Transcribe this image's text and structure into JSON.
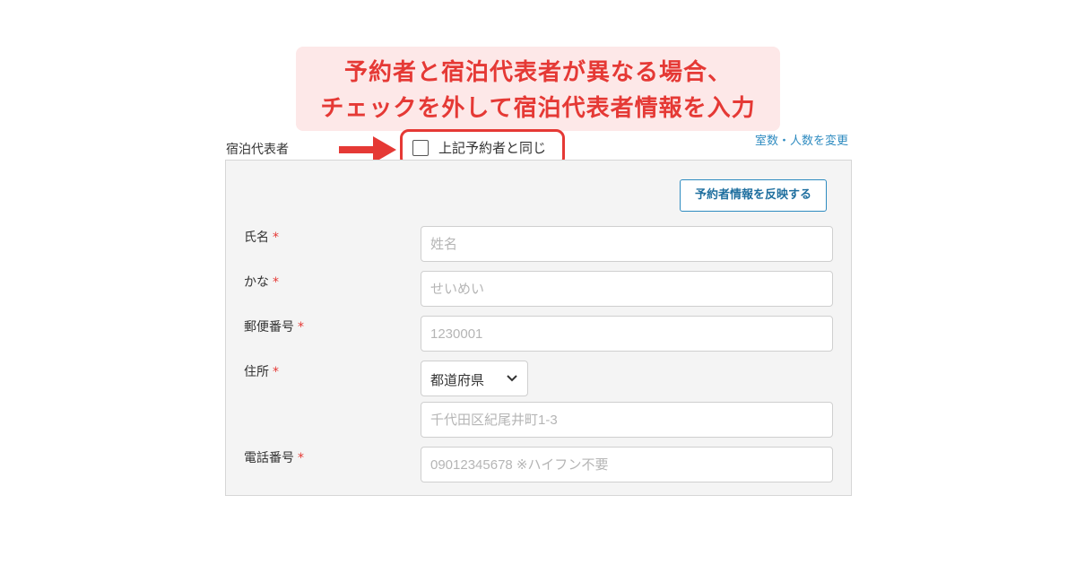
{
  "callout": {
    "line1": "予約者と宿泊代表者が異なる場合、",
    "line2": "チェックを外して宿泊代表者情報を入力"
  },
  "section": {
    "label": "宿泊代表者",
    "same_as_booker_label": "上記予約者と同じ",
    "same_as_booker_checked": false,
    "change_link": "室数・人数を変更"
  },
  "form": {
    "reflect_button": "予約者情報を反映する",
    "required_mark": "*",
    "name": {
      "label": "氏名",
      "placeholder": "姓名"
    },
    "kana": {
      "label": "かな",
      "placeholder": "せいめい"
    },
    "postal": {
      "label": "郵便番号",
      "placeholder": "1230001"
    },
    "address": {
      "label": "住所",
      "prefecture_selected": "都道府県",
      "placeholder": "千代田区紀尾井町1-3"
    },
    "phone": {
      "label": "電話番号",
      "placeholder": "09012345678 ※ハイフン不要"
    }
  },
  "colors": {
    "accent_red": "#e53935",
    "callout_bg": "#fde8e8",
    "link_blue": "#2e8bc0",
    "panel_bg": "#f4f4f4"
  },
  "icons": {
    "arrow": "arrow-right-icon",
    "select": "chevron-down-icon"
  }
}
